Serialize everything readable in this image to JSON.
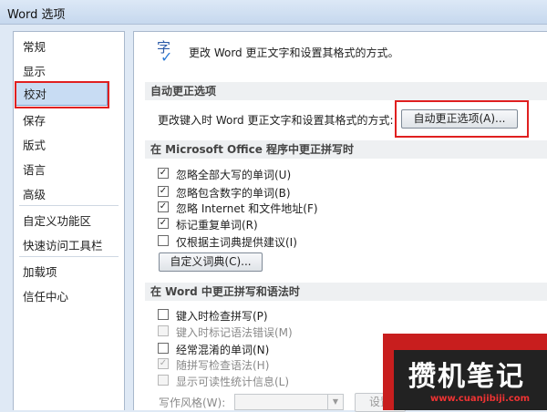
{
  "window": {
    "title": "Word 选项"
  },
  "sidebar": {
    "items": [
      {
        "label": "常规",
        "selected": false
      },
      {
        "label": "显示",
        "selected": false
      },
      {
        "label": "校对",
        "selected": true
      },
      {
        "label": "保存",
        "selected": false
      },
      {
        "label": "版式",
        "selected": false
      },
      {
        "label": "语言",
        "selected": false
      },
      {
        "label": "高级",
        "selected": false
      },
      {
        "label": "自定义功能区",
        "selected": false
      },
      {
        "label": "快速访问工具栏",
        "selected": false
      },
      {
        "label": "加载项",
        "selected": false
      },
      {
        "label": "信任中心",
        "selected": false
      }
    ]
  },
  "header": {
    "icon": "proofing-abc-check-icon",
    "icon_glyph": "字",
    "text": "更改 Word 更正文字和设置其格式的方式。"
  },
  "autocorrect": {
    "title": "自动更正选项",
    "row_label": "更改键入时 Word 更正文字和设置其格式的方式:",
    "button_label": "自动更正选项(A)..."
  },
  "office_spelling": {
    "title": "在 Microsoft Office 程序中更正拼写时",
    "options": [
      {
        "label": "忽略全部大写的单词(U)",
        "checked": true,
        "enabled": true
      },
      {
        "label": "忽略包含数字的单词(B)",
        "checked": true,
        "enabled": true
      },
      {
        "label": "忽略 Internet 和文件地址(F)",
        "checked": true,
        "enabled": true
      },
      {
        "label": "标记重复单词(R)",
        "checked": true,
        "enabled": true
      },
      {
        "label": "仅根据主词典提供建议(I)",
        "checked": false,
        "enabled": true
      }
    ],
    "dictionary_button": "自定义词典(C)..."
  },
  "word_spelling": {
    "title": "在 Word 中更正拼写和语法时",
    "options": [
      {
        "label": "键入时检查拼写(P)",
        "checked": false,
        "enabled": true
      },
      {
        "label": "键入时标记语法错误(M)",
        "checked": false,
        "enabled": false
      },
      {
        "label": "经常混淆的单词(N)",
        "checked": false,
        "enabled": true
      },
      {
        "label": "随拼写检查语法(H)",
        "checked": true,
        "enabled": false
      },
      {
        "label": "显示可读性统计信息(L)",
        "checked": false,
        "enabled": false
      }
    ],
    "writing_style_label": "写作风格(W):",
    "writing_style_value": "",
    "settings_button": "设置"
  },
  "watermark": {
    "title": "攒机笔记",
    "url": "www.cuanjibiji.com"
  },
  "colors": {
    "highlight": "#e02020",
    "selection": "#c8dcf3",
    "accent": "#2d7bd6"
  }
}
